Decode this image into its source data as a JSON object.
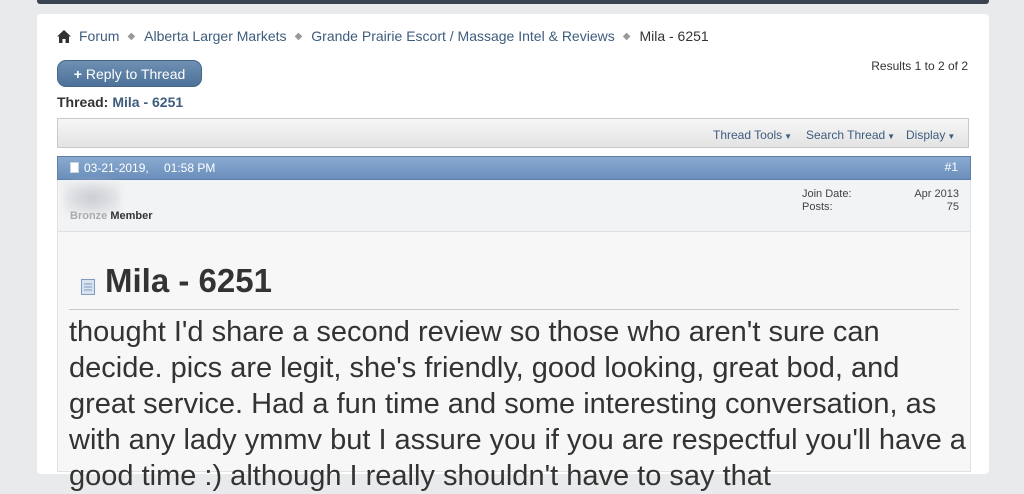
{
  "breadcrumb": {
    "items": [
      "Forum",
      "Alberta Larger Markets",
      "Grande Prairie Escort / Massage Intel & Reviews"
    ],
    "current": "Mila - 6251"
  },
  "actions": {
    "reply_label": "Reply to Thread",
    "reply_plus": "+"
  },
  "results": "Results 1 to 2 of 2",
  "thread": {
    "label": "Thread:",
    "title": "Mila - 6251"
  },
  "toolbar": {
    "tools": "Thread Tools",
    "search": "Search Thread",
    "display": "Display"
  },
  "post": {
    "date": "03-21-2019,",
    "time": "01:58 PM",
    "number": "#1",
    "rank_faded": "Bronze",
    "rank": "Member",
    "join_label": "Join Date:",
    "join_value": "Apr 2013",
    "posts_label": "Posts:",
    "posts_value": "75",
    "title": "Mila - 6251",
    "body": "thought I'd share a second review so those who aren't sure can decide. pics are legit, she's friendly, good looking, great bod, and great service. Had a fun time and some interesting conversation, as with any lady ymmv but I assure you if you are respectful you'll have a good time :) although I really shouldn't have to say that"
  },
  "colors": {
    "link": "#3e5c7e",
    "post_header": "#7a9cc6",
    "button": "#5b7ea5"
  }
}
